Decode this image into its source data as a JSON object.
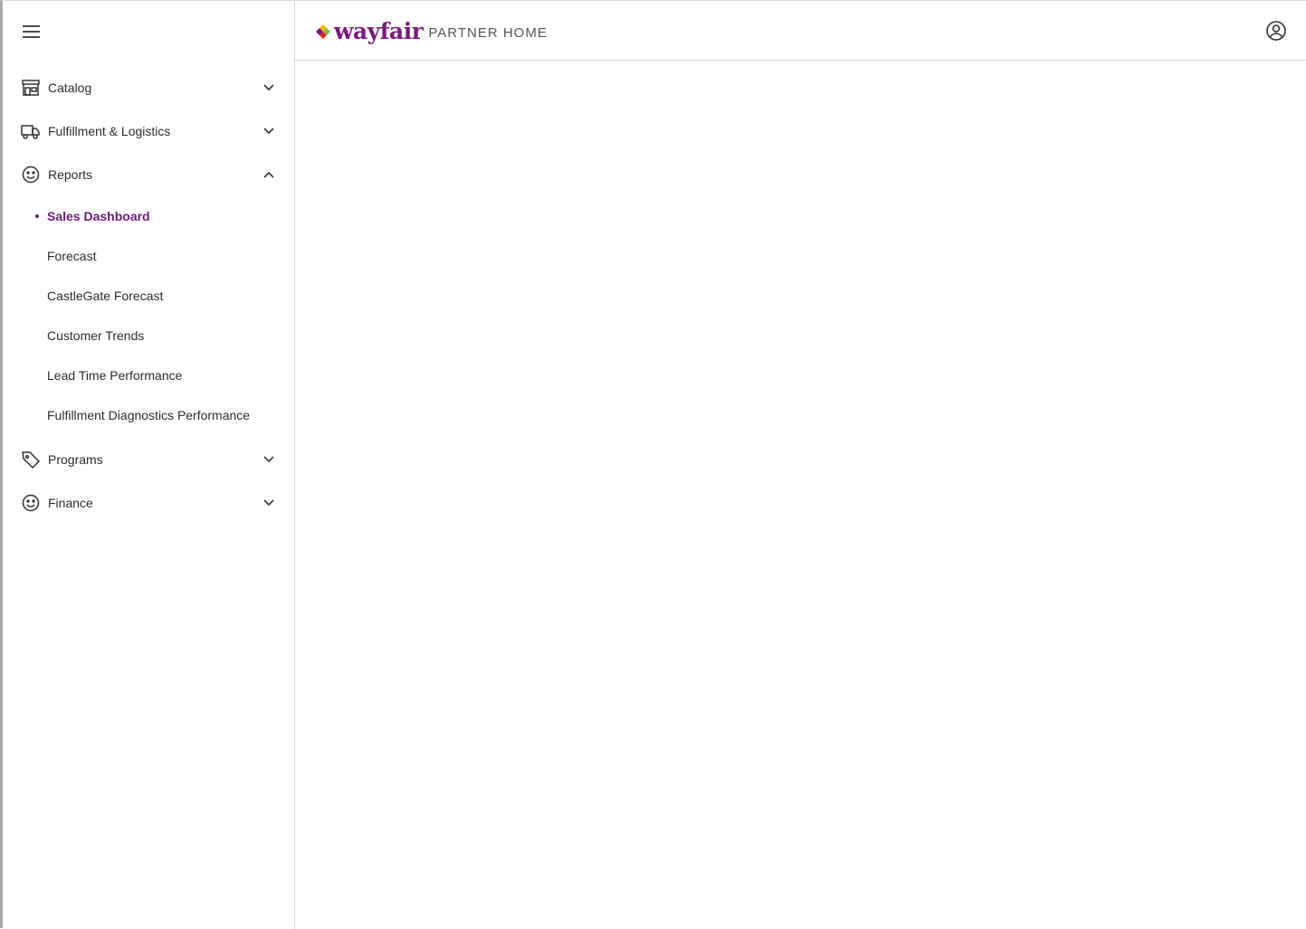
{
  "header": {
    "logo_word": "wayfair",
    "logo_sub": "PARTNER HOME"
  },
  "sidebar": {
    "items": [
      {
        "label": "Catalog",
        "icon": "store-icon",
        "expanded": false
      },
      {
        "label": "Fulfillment & Logistics",
        "icon": "truck-icon",
        "expanded": false
      },
      {
        "label": "Reports",
        "icon": "smiley-icon",
        "expanded": true,
        "children": [
          {
            "label": "Sales Dashboard",
            "active": true
          },
          {
            "label": "Forecast"
          },
          {
            "label": "CastleGate Forecast"
          },
          {
            "label": "Customer Trends"
          },
          {
            "label": "Lead Time Performance"
          },
          {
            "label": "Fulfillment Diagnostics Performance"
          }
        ]
      },
      {
        "label": "Programs",
        "icon": "tag-icon",
        "expanded": false
      },
      {
        "label": "Finance",
        "icon": "smiley-icon",
        "expanded": false
      }
    ]
  },
  "colors": {
    "brand": "#7b1a7f",
    "active": "#6b1a78",
    "text": "#2b2b2b",
    "border": "#d9d9d9"
  }
}
